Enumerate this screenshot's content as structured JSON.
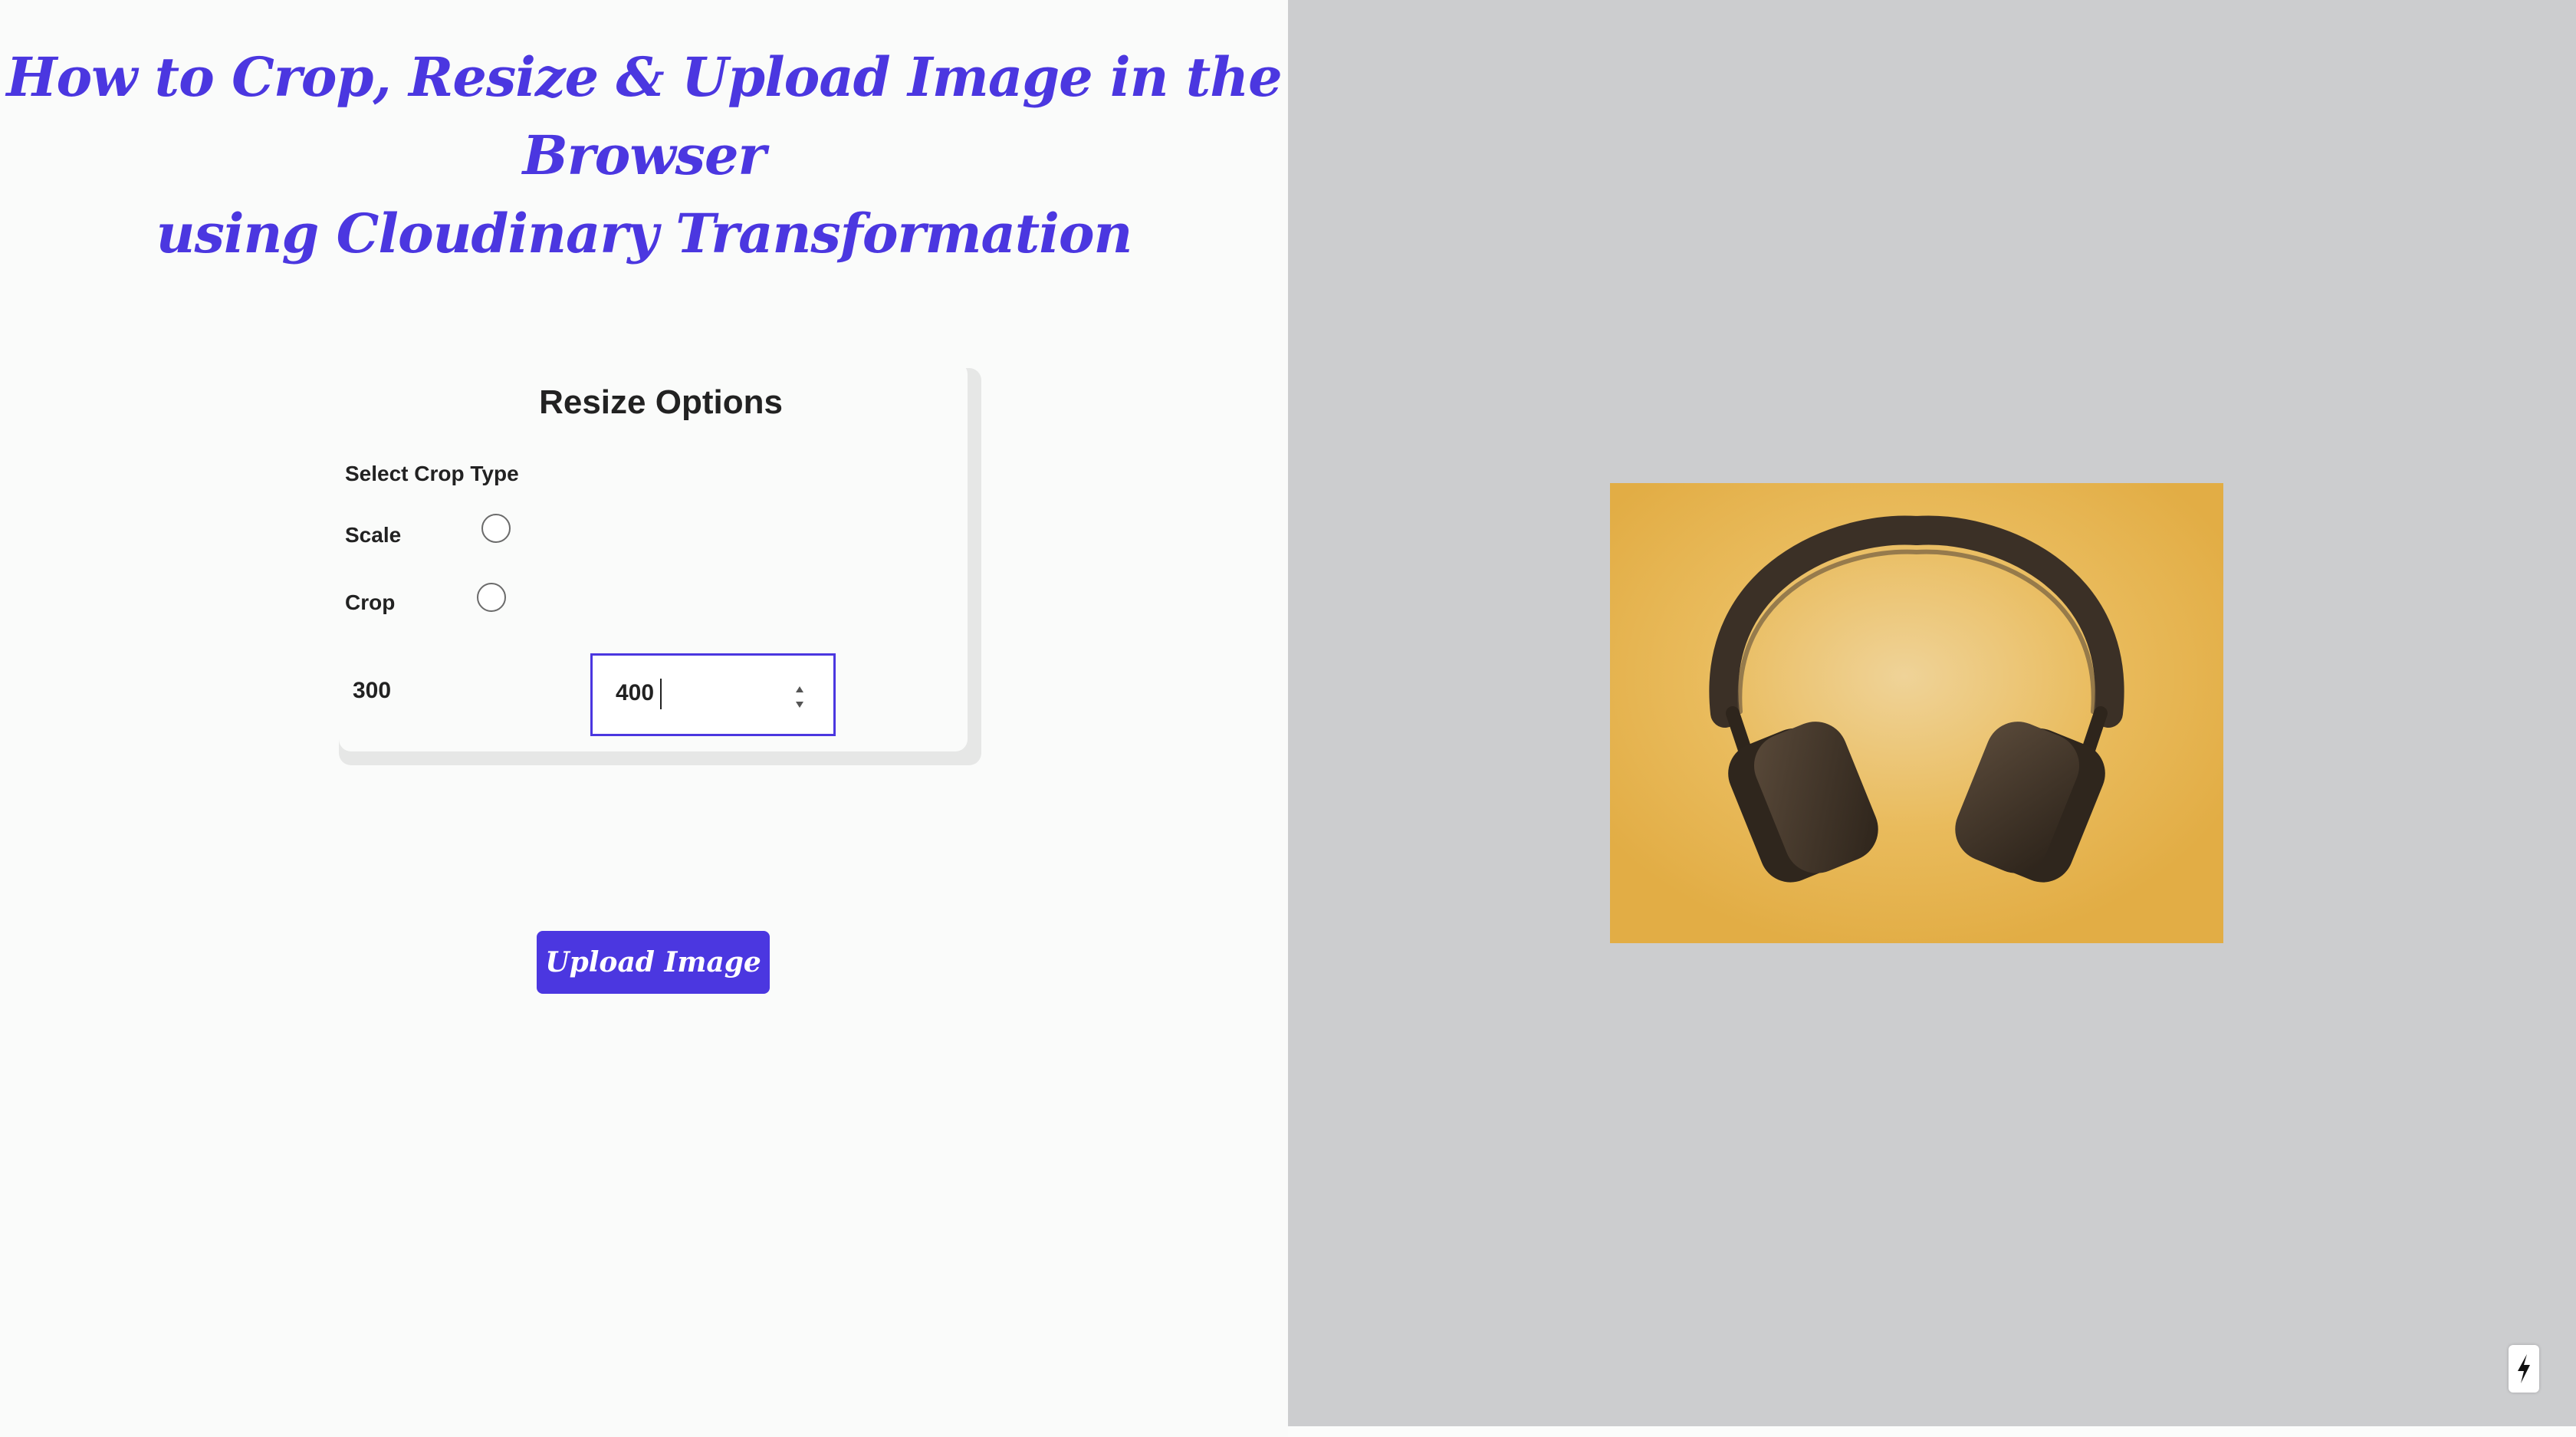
{
  "page": {
    "title": "How to Crop, Resize & Upload Image in the Browser using Cloudinary Transformation",
    "title_line1": "How to Crop, Resize & Upload Image in the Browser",
    "title_line2": "using Cloudinary Transformation"
  },
  "resize": {
    "heading": "Resize Options",
    "crop_type_label": "Select Crop Type",
    "options": [
      {
        "label": "Scale",
        "selected": false
      },
      {
        "label": "Crop",
        "selected": false
      }
    ],
    "width_value": "300",
    "height_value": "400"
  },
  "actions": {
    "upload_label": "Upload Image"
  },
  "preview": {
    "image_subject": "headphones-photo"
  },
  "colors": {
    "accent": "#4b37e0",
    "preview_bg": "#cccdcf",
    "photo_bg": "#e5b04a"
  },
  "icons": {
    "dev_indicator": "lightning-icon"
  }
}
